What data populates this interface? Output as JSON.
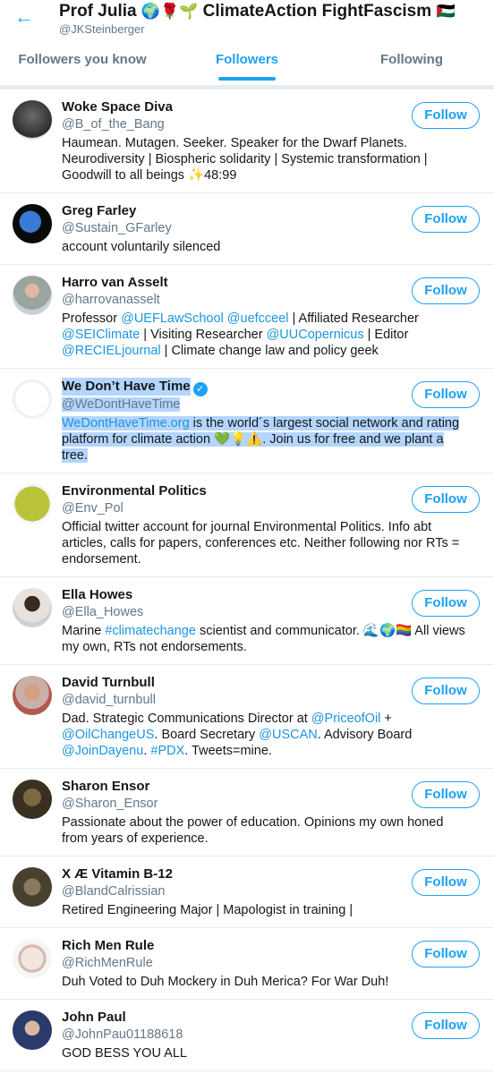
{
  "header": {
    "back_icon": "arrow-left-icon",
    "title_name": "Prof Julia",
    "title_emojis": "🌍🌹🌱",
    "title_rest": "ClimateAction FightFascism",
    "title_flag": "🇵🇸",
    "handle": "@JKSteinberger"
  },
  "tabs": [
    {
      "label": "Followers you know",
      "active": false
    },
    {
      "label": "Followers",
      "active": true
    },
    {
      "label": "Following",
      "active": false
    }
  ],
  "follow_label": "Follow",
  "colors": {
    "accent": "#1da1f2",
    "link": "#1b95e0",
    "selection": "#b4d5fe"
  },
  "users": [
    {
      "name": "Woke Space Diva",
      "handle": "@B_of_the_Bang",
      "bio": [
        {
          "t": "Haumean. Mutagen. Seeker. Speaker for the Dwarf Planets. Neurodiversity | Biospheric solidarity | Systemic transformation | Goodwill to all beings ✨48:99"
        }
      ]
    },
    {
      "name": "Greg Farley",
      "handle": "@Sustain_GFarley",
      "bio": [
        {
          "t": "account voluntarily silenced"
        }
      ]
    },
    {
      "name": "Harro van Asselt",
      "handle": "@harrovanasselt",
      "bio": [
        {
          "t": "Professor "
        },
        {
          "t": "@UEFLawSchool",
          "link": true
        },
        {
          "t": " "
        },
        {
          "t": "@uefcceel",
          "link": true
        },
        {
          "t": " | Affiliated Researcher "
        },
        {
          "t": "@SEIClimate",
          "link": true
        },
        {
          "t": " | Visiting Researcher "
        },
        {
          "t": "@UUCopernicus",
          "link": true
        },
        {
          "t": " | Editor "
        },
        {
          "t": "@RECIELjournal",
          "link": true
        },
        {
          "t": " | Climate change law and policy geek"
        }
      ]
    },
    {
      "name": "We Don’t Have Time",
      "handle": "@WeDontHaveTime",
      "verified": true,
      "selected": true,
      "bio": [
        {
          "t": "WeDontHaveTime.org",
          "link": true
        },
        {
          "t": " is the world´s largest social network and rating platform for climate action 💚💡⚠️. Join us for free and we plant a tree."
        }
      ]
    },
    {
      "name": "Environmental Politics",
      "handle": "@Env_Pol",
      "bio": [
        {
          "t": "Official twitter account for journal Environmental Politics. Info abt articles, calls for papers, conferences etc. Neither following nor RTs = endorsement."
        }
      ]
    },
    {
      "name": "Ella Howes",
      "handle": "@Ella_Howes",
      "bio": [
        {
          "t": "Marine "
        },
        {
          "t": "#climatechange",
          "link": true
        },
        {
          "t": " scientist and communicator. 🌊🌍🏳️‍🌈 All views my own, RTs not endorsements."
        }
      ]
    },
    {
      "name": "David Turnbull",
      "handle": "@david_turnbull",
      "bio": [
        {
          "t": "Dad. Strategic Communications Director at "
        },
        {
          "t": "@PriceofOil",
          "link": true
        },
        {
          "t": " + "
        },
        {
          "t": "@OilChangeUS",
          "link": true
        },
        {
          "t": ". Board Secretary "
        },
        {
          "t": "@USCAN",
          "link": true
        },
        {
          "t": ". Advisory Board "
        },
        {
          "t": "@JoinDayenu",
          "link": true
        },
        {
          "t": ". "
        },
        {
          "t": "#PDX",
          "link": true
        },
        {
          "t": ". Tweets=mine."
        }
      ]
    },
    {
      "name": "Sharon Ensor",
      "handle": "@Sharon_Ensor",
      "bio": [
        {
          "t": "Passionate about the power of education. Opinions my own honed from years of experience."
        }
      ]
    },
    {
      "name": "X Æ Vitamin B-12",
      "handle": "@BlandCalrissian",
      "bio": [
        {
          "t": "Retired Engineering Major | Mapologist in training |"
        }
      ]
    },
    {
      "name": "Rich Men Rule",
      "handle": "@RichMenRule",
      "bio": [
        {
          "t": "Duh Voted to Duh Mockery in Duh Merica? For War Duh!"
        }
      ]
    },
    {
      "name": "John Paul",
      "handle": "@JohnPau01188618",
      "bio": [
        {
          "t": "GOD BESS YOU ALL"
        }
      ]
    }
  ]
}
